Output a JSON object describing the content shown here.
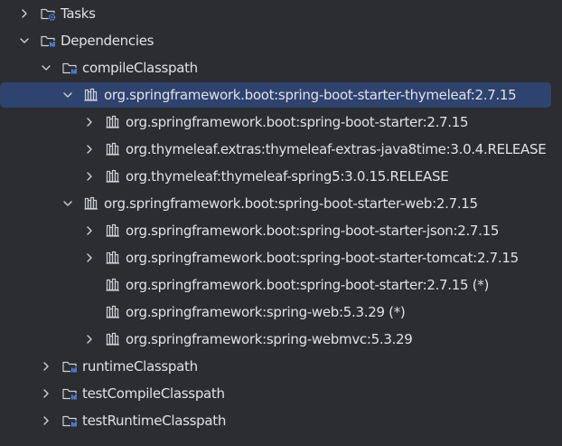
{
  "tree": {
    "rows": [
      {
        "label": "Tasks",
        "chevron": "right",
        "icon": "gear-folder-icon"
      },
      {
        "label": "Dependencies",
        "chevron": "down",
        "icon": "library-folder-icon"
      },
      {
        "label": "compileClasspath",
        "chevron": "down",
        "icon": "library-folder-icon"
      },
      {
        "label": "org.springframework.boot:spring-boot-starter-thymeleaf:2.7.15",
        "chevron": "down",
        "icon": "library-icon",
        "selected": true
      },
      {
        "label": "org.springframework.boot:spring-boot-starter:2.7.15",
        "chevron": "right",
        "icon": "library-icon"
      },
      {
        "label": "org.thymeleaf.extras:thymeleaf-extras-java8time:3.0.4.RELEASE",
        "chevron": "right",
        "icon": "library-icon"
      },
      {
        "label": "org.thymeleaf:thymeleaf-spring5:3.0.15.RELEASE",
        "chevron": "right",
        "icon": "library-icon"
      },
      {
        "label": "org.springframework.boot:spring-boot-starter-web:2.7.15",
        "chevron": "down",
        "icon": "library-icon"
      },
      {
        "label": "org.springframework.boot:spring-boot-starter-json:2.7.15",
        "chevron": "right",
        "icon": "library-icon"
      },
      {
        "label": "org.springframework.boot:spring-boot-starter-tomcat:2.7.15",
        "chevron": "right",
        "icon": "library-icon"
      },
      {
        "label": "org.springframework.boot:spring-boot-starter:2.7.15 (*)",
        "chevron": "none",
        "icon": "library-icon"
      },
      {
        "label": "org.springframework:spring-web:5.3.29 (*)",
        "chevron": "none",
        "icon": "library-icon"
      },
      {
        "label": "org.springframework:spring-webmvc:5.3.29",
        "chevron": "right",
        "icon": "library-icon"
      },
      {
        "label": "runtimeClasspath",
        "chevron": "right",
        "icon": "library-folder-icon"
      },
      {
        "label": "testCompileClasspath",
        "chevron": "right",
        "icon": "library-folder-icon"
      },
      {
        "label": "testRuntimeClasspath",
        "chevron": "right",
        "icon": "library-folder-icon"
      }
    ]
  },
  "colors": {
    "background": "#2b2d30",
    "selection": "#2e436e",
    "text": "#dfe1e5",
    "icon": "#ced0d6",
    "accent": "#548af7"
  }
}
